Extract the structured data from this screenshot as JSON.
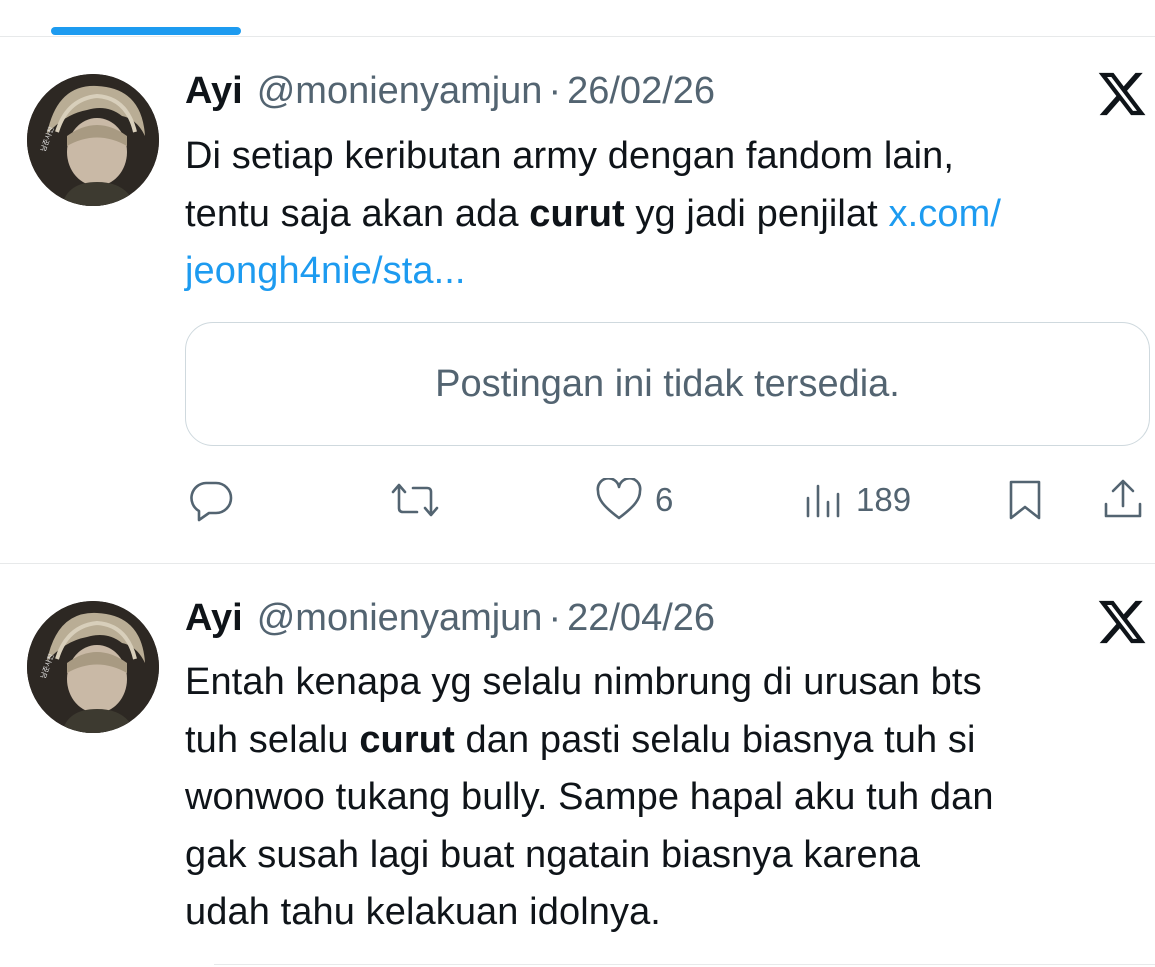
{
  "tweets": [
    {
      "author_name": "Ayi",
      "handle": "@monienyamjun",
      "separator": "·",
      "date": "26/02/26",
      "text_parts": {
        "a": "Di setiap keributan army dengan fandom lain,",
        "b": "tentu saja akan ada ",
        "bold": "curut",
        "c": " yg jadi penjilat ",
        "link1": "x.com/",
        "link2": "jeongh4nie/sta..."
      },
      "quoted_unavailable": "Postingan ini tidak tersedia.",
      "actions": {
        "reply_icon": "reply-icon",
        "retweet_icon": "retweet-icon",
        "like_icon": "heart-icon",
        "like_count": "6",
        "views_icon": "views-icon",
        "views_count": "189",
        "bookmark_icon": "bookmark-icon",
        "share_icon": "share-icon"
      },
      "logo": "x-logo"
    },
    {
      "author_name": "Ayi",
      "handle": "@monienyamjun",
      "separator": "·",
      "date": "22/04/26",
      "text_parts": {
        "l1": "Entah kenapa yg selalu nimbrung di urusan bts",
        "l2a": "tuh selalu ",
        "bold": "curut",
        "l2b": " dan pasti selalu biasnya tuh si",
        "l3": "wonwoo tukang bully. Sampe hapal aku tuh dan",
        "l4": "gak susah lagi buat ngatain biasnya karena",
        "l5": "udah tahu kelakuan idolnya."
      },
      "logo": "x-logo"
    }
  ],
  "colors": {
    "accent": "#1d9bf0",
    "text": "#0f1419",
    "muted": "#536471",
    "border": "#cfd9de"
  }
}
